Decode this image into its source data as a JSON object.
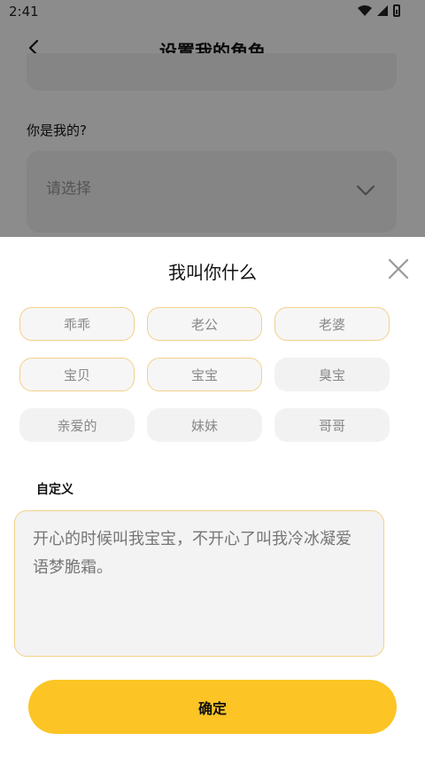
{
  "status_bar": {
    "time": "2:41"
  },
  "header": {
    "title": "设置我的角色",
    "back_icon": "chevron-left-icon"
  },
  "background": {
    "question": "你是我的?",
    "select_placeholder": "请选择",
    "select_icon": "chevron-down-icon"
  },
  "sheet": {
    "title": "我叫你什么",
    "close_icon": "close-icon",
    "chips": [
      {
        "label": "乖乖",
        "selected": true
      },
      {
        "label": "老公",
        "selected": true
      },
      {
        "label": "老婆",
        "selected": true
      },
      {
        "label": "宝贝",
        "selected": true
      },
      {
        "label": "宝宝",
        "selected": true
      },
      {
        "label": "臭宝",
        "selected": false
      },
      {
        "label": "亲爱的",
        "selected": false
      },
      {
        "label": "妹妹",
        "selected": false
      },
      {
        "label": "哥哥",
        "selected": false
      }
    ],
    "custom_label": "自定义",
    "custom_placeholder": "开心的时候叫我宝宝，不开心了叫我冷冰凝爱语梦脆霜。",
    "confirm_label": "确定"
  },
  "colors": {
    "accent": "#fcc425",
    "chip_border": "#f3d08a",
    "chip_bg": "#f2f2f2"
  }
}
